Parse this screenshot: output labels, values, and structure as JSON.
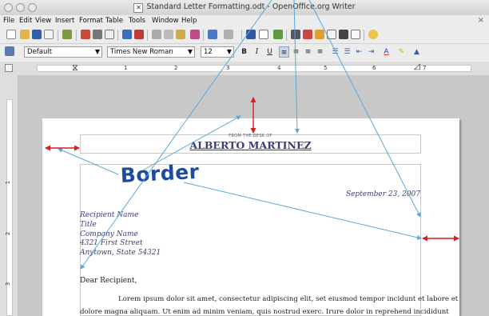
{
  "window": {
    "title": "Standard Letter Formatting.odt - OpenOffice.org Writer"
  },
  "menu": {
    "items": [
      "File",
      "Edit",
      "View",
      "Insert",
      "Format",
      "Table",
      "Tools",
      "Window",
      "Help"
    ]
  },
  "format_bar": {
    "style": "Default",
    "font": "Times New Roman",
    "size": "12"
  },
  "ruler": {
    "h_numbers": [
      "1",
      "2",
      "3",
      "4",
      "5",
      "6",
      "7"
    ],
    "v_numbers": [
      "1",
      "2",
      "3"
    ]
  },
  "letter": {
    "desk_of": "FROM THE DESK OF",
    "sender_name": "ALBERTO MARTINEZ",
    "date": "September 23, 2007",
    "recipient": [
      "Recipient Name",
      "Title",
      "Company Name",
      "4321 First Street",
      "Anytown, State 54321"
    ],
    "salutation": "Dear Recipient,",
    "body_line1": "Lorem ipsum dolor sit amet, consectetur adipiscing elit, set eiusmod tempor incidunt et labore et",
    "body_line2": "dolore magna aliquam. Ut enim ad minim veniam, quis nostrud exerc. Irure dolor in reprehend incididunt"
  },
  "annotation": {
    "label": "Border",
    "arrow_color": "#5aa8d8",
    "margin_arrow_color": "#d42020"
  },
  "colors": {
    "heading": "#3a3d7a",
    "border_label": "#1f4c9a"
  }
}
